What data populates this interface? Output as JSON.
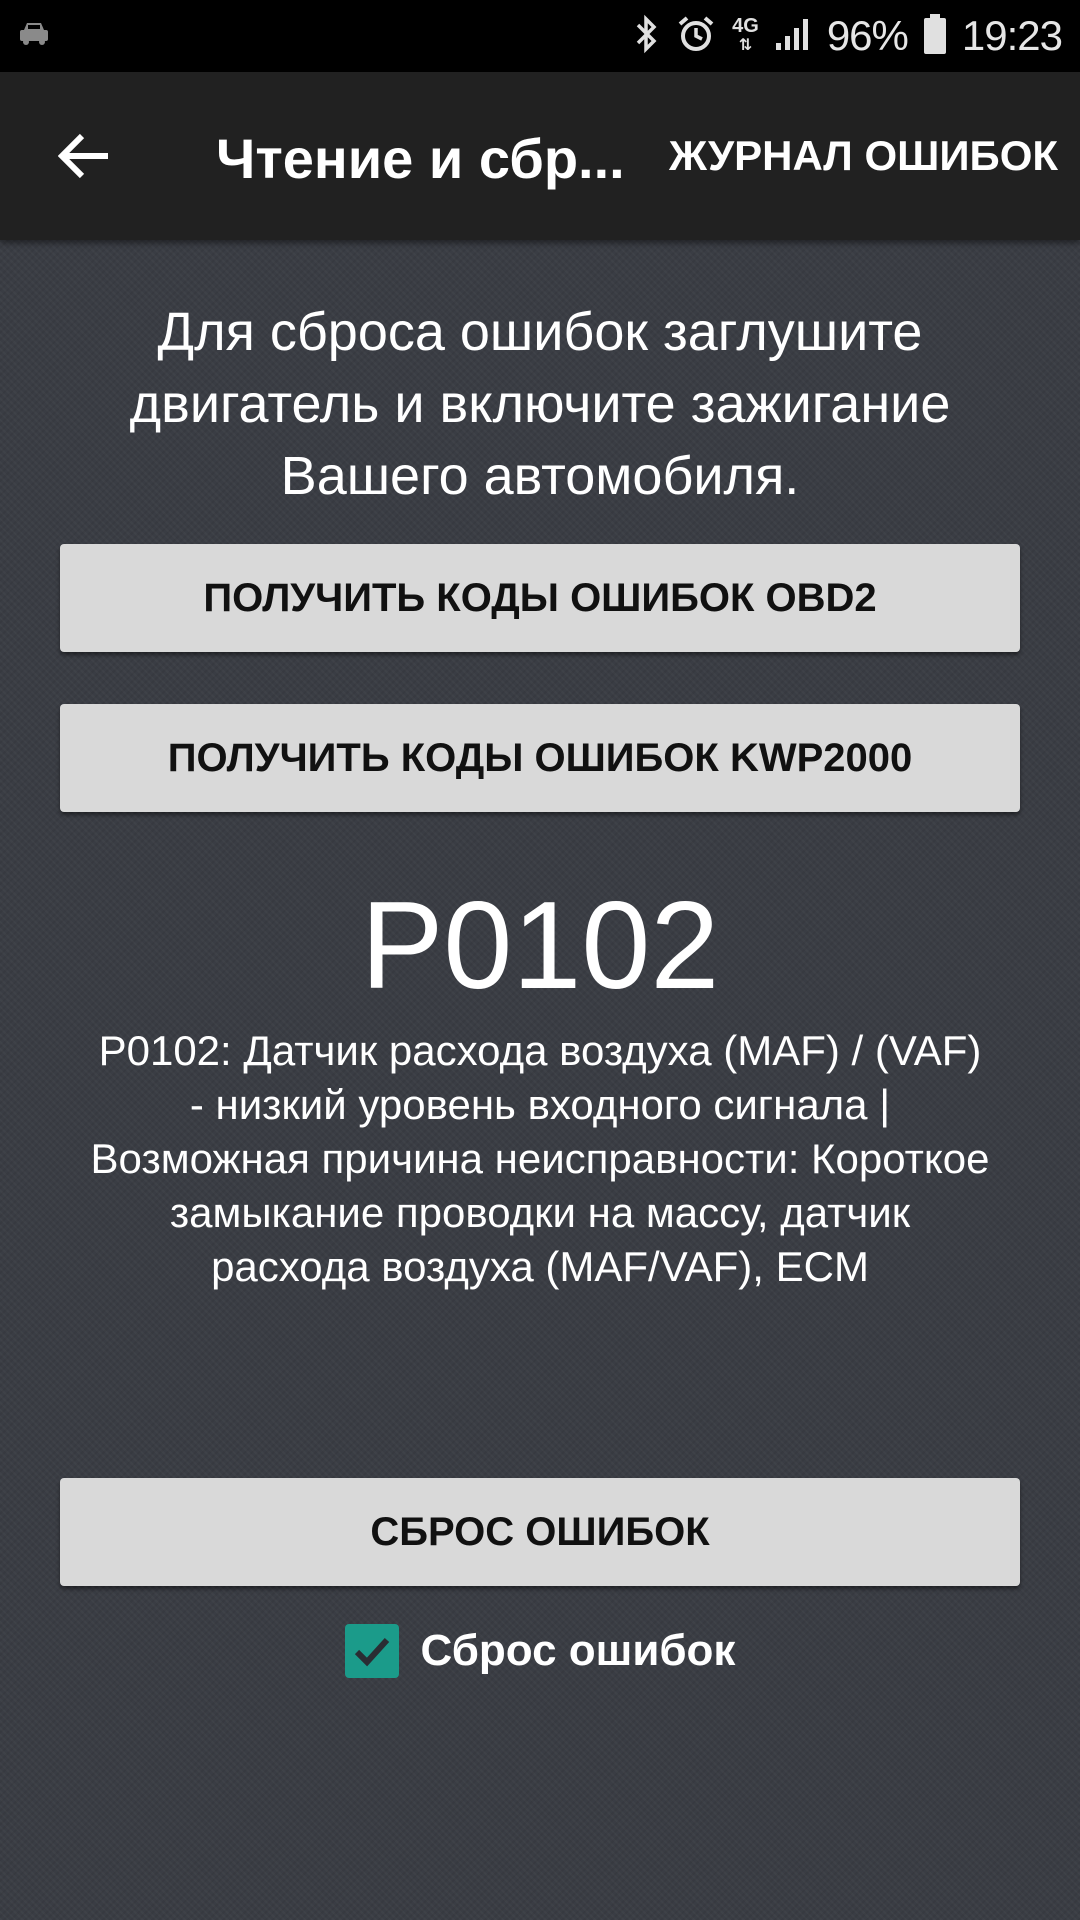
{
  "status_bar": {
    "network": "4G",
    "battery": "96%",
    "time": "19:23",
    "icons": [
      "car-icon",
      "bluetooth-icon",
      "alarm-icon",
      "signal-icon",
      "battery-icon"
    ]
  },
  "app_bar": {
    "title": "Чтение и сбр...",
    "action_label": "ЖУРНАЛ ОШИБОК"
  },
  "main": {
    "instruction": "Для сброса ошибок заглушите двигатель и включите зажигание Вашего автомобиля.",
    "button_obd2": "ПОЛУЧИТЬ КОДЫ ОШИБОК OBD2",
    "button_kwp": "ПОЛУЧИТЬ КОДЫ ОШИБОК KWP2000",
    "error_code": "P0102",
    "error_description": "P0102: Датчик расхода воздуха (MAF) / (VAF) - низкий уровень входного сигнала | Возможная причина неисправности: Короткое замыкание проводки на массу, датчик расхода воздуха (MAF/VAF), ECM",
    "button_reset": "СБРОС ОШИБОК",
    "checkbox_label": "Сброс ошибок",
    "checkbox_checked": true
  },
  "colors": {
    "accent": "#1b9b8a",
    "app_bar": "#212121",
    "background": "#3a3d44",
    "button": "#d9d9d9"
  }
}
